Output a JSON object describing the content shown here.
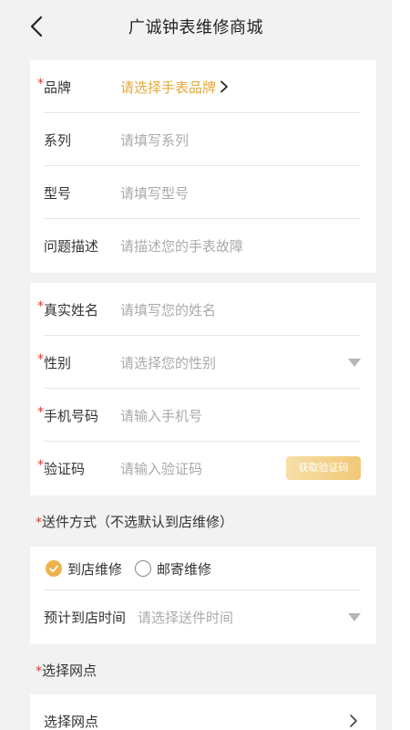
{
  "header": {
    "title": "广诚钟表维修商城",
    "back_icon": "chevron-left-icon"
  },
  "watch_info": {
    "brand": {
      "label": "品牌",
      "required": true,
      "placeholder": "请选择手表品牌"
    },
    "series": {
      "label": "系列",
      "required": false,
      "placeholder": "请填写系列"
    },
    "model": {
      "label": "型号",
      "required": false,
      "placeholder": "请填写型号"
    },
    "problem": {
      "label": "问题描述",
      "required": false,
      "placeholder": "请描述您的手表故障"
    }
  },
  "user_info": {
    "name": {
      "label": "真实姓名",
      "required": true,
      "placeholder": "请填写您的姓名"
    },
    "gender": {
      "label": "性别",
      "required": true,
      "placeholder": "请选择您的性别"
    },
    "phone": {
      "label": "手机号码",
      "required": true,
      "placeholder": "请输入手机号"
    },
    "code": {
      "label": "验证码",
      "required": true,
      "placeholder": "请输入验证码",
      "button": "获取验证码"
    }
  },
  "delivery": {
    "section_title": "送件方式（不选默认到店维修）",
    "options": [
      {
        "label": "到店维修",
        "selected": true
      },
      {
        "label": "邮寄维修",
        "selected": false
      }
    ],
    "time": {
      "label": "预计到店时间",
      "placeholder": "请选择送件时间"
    }
  },
  "outlet": {
    "section_title": "选择网点",
    "row_label": "选择网点"
  },
  "colors": {
    "accent": "#e2a93c",
    "required": "#d63a2f",
    "placeholder": "#aaaaaa"
  },
  "required_mark": "*"
}
